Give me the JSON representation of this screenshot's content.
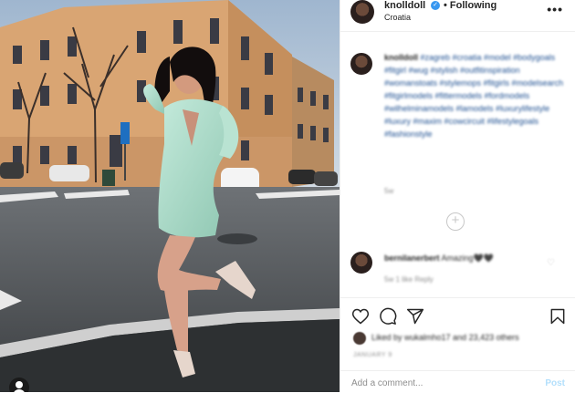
{
  "post": {
    "username": "knolldoll",
    "follow_state": "Following",
    "location": "Croatia",
    "more_label": "•••"
  },
  "caption": {
    "username": "knolldoll",
    "text": "#zagreb #croatia #model #bodygoals #fitgirl #wug #stylish #outfitinspiration #womanstoats #stylemops #fitgirls #modelsearch #fitgirlmodels #fittermodels #fordmodels #wilhelminamodels #lamodels #luxurylifestyle #luxury #maxim #cowcircuit #lifestylegoals #fashionstyle",
    "time": "5w"
  },
  "comment": {
    "username": "bernilanerbert",
    "text": "Amazing🖤🖤",
    "meta": "5w   1 like   Reply"
  },
  "likes": {
    "text": "Liked by wukalmho17 and 23,423 others"
  },
  "date": "JANUARY 9",
  "add_comment": {
    "placeholder": "Add a comment...",
    "post_label": "Post"
  },
  "icons": {
    "verified": "verified-badge-icon",
    "like": "heart-icon",
    "comment": "comment-icon",
    "share": "paper-plane-icon",
    "save": "bookmark-icon",
    "load_more": "plus-circle-icon",
    "user_tag": "user-tag-icon"
  },
  "colors": {
    "link_blue": "#1d4f91",
    "verified_blue": "#3897f0",
    "post_button": "#b2dffc",
    "dress": "#a7d6c3"
  }
}
